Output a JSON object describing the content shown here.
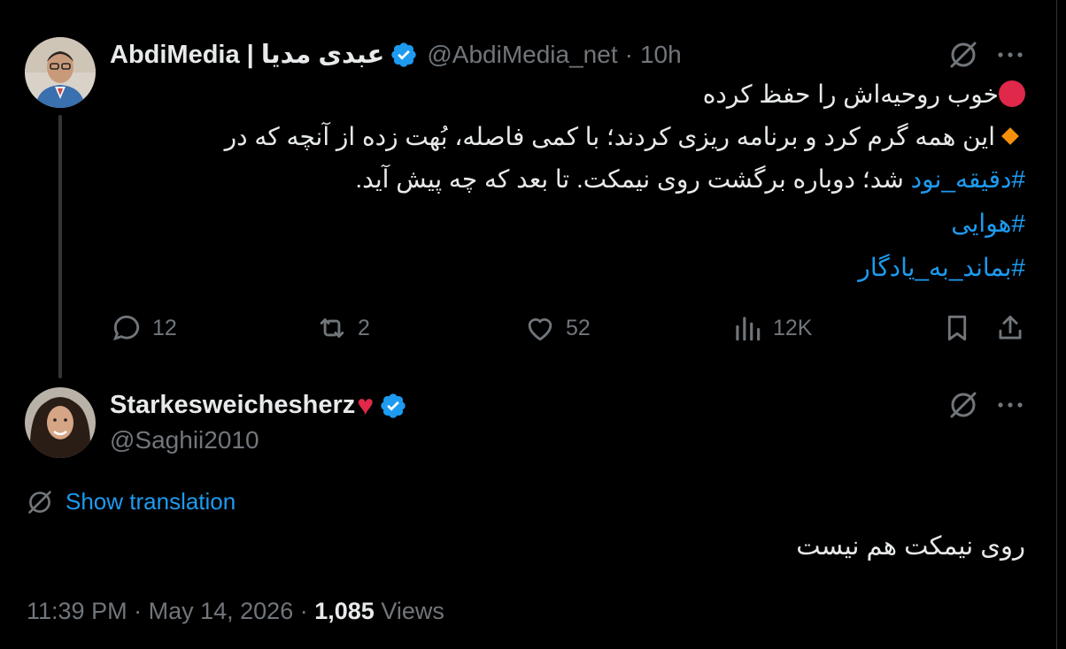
{
  "tweet1": {
    "display_name": "AbdiMedia | عبدی مدیا",
    "handle": "@AbdiMedia_net",
    "separator": "·",
    "time": "10h",
    "line1": "خوب روحیه‌اش را حفظ کرده",
    "line2": "این همه گرم کرد و برنامه ریزی کردند؛ با کمی فاصله، بُهت زده از آنچه که در",
    "line3_hashtag": "#دقیقه_نود",
    "line3_text": " شد؛ دوباره برگشت روی نیمکت. تا بعد که چه پیش آید.",
    "hashtag2": "#هوایی",
    "hashtag3": "#بماند_به_یادگار",
    "replies": "12",
    "reposts": "2",
    "likes": "52",
    "views": "12K"
  },
  "tweet2": {
    "display_name": "Starkesweichesherz",
    "heart_emoji": "♥",
    "handle": "@Saghii2010",
    "show_translation": "Show translation",
    "text": "روی نیمکت هم نیست",
    "time": "11:39 PM",
    "separator": "·",
    "date": "May 14, 2026",
    "separator2": "·",
    "views_count": "1,085",
    "views_label": "Views"
  },
  "colors": {
    "background": "#000000",
    "text": "#e7e9ea",
    "muted": "#71767b",
    "accent": "#1d9bf0",
    "red": "#e0284a",
    "orange": "#f4900c"
  }
}
